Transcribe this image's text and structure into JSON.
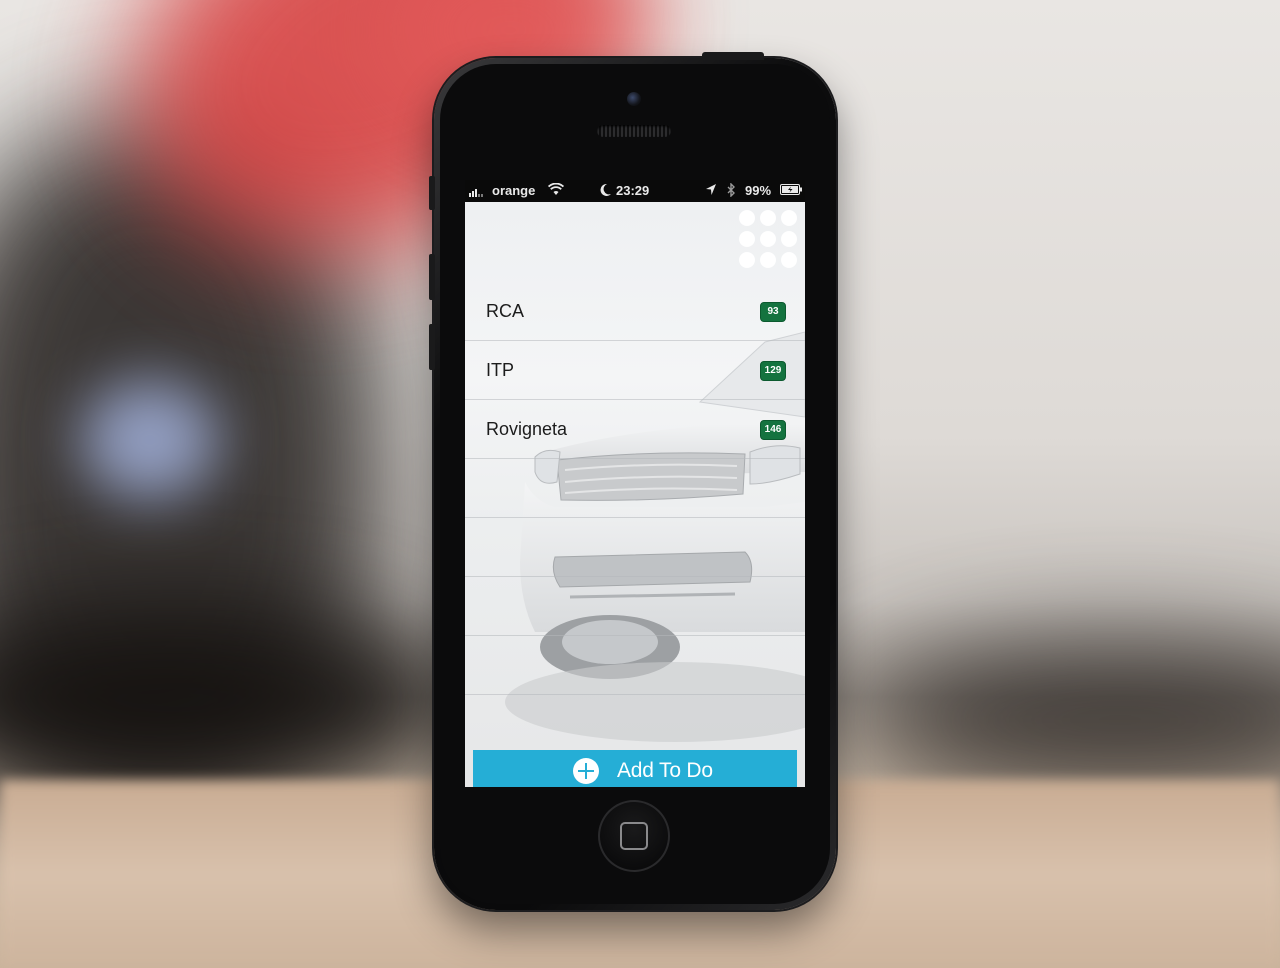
{
  "status_bar": {
    "carrier": "orange",
    "time": "23:29",
    "battery": "99%",
    "icons": [
      "signal-icon",
      "wifi-icon",
      "moon-icon",
      "location-icon",
      "bluetooth-icon",
      "battery-icon"
    ]
  },
  "header": {
    "menu_icon": "grid-menu-icon"
  },
  "items": [
    {
      "label": "RCA",
      "count": "93"
    },
    {
      "label": "ITP",
      "count": "129"
    },
    {
      "label": "Rovigneta",
      "count": "146"
    }
  ],
  "add_button": {
    "label": "Add To Do",
    "icon": "plus-circle-icon"
  },
  "colors": {
    "accent": "#25aed6",
    "badge": "#14733f",
    "text": "#1c1c1c"
  }
}
